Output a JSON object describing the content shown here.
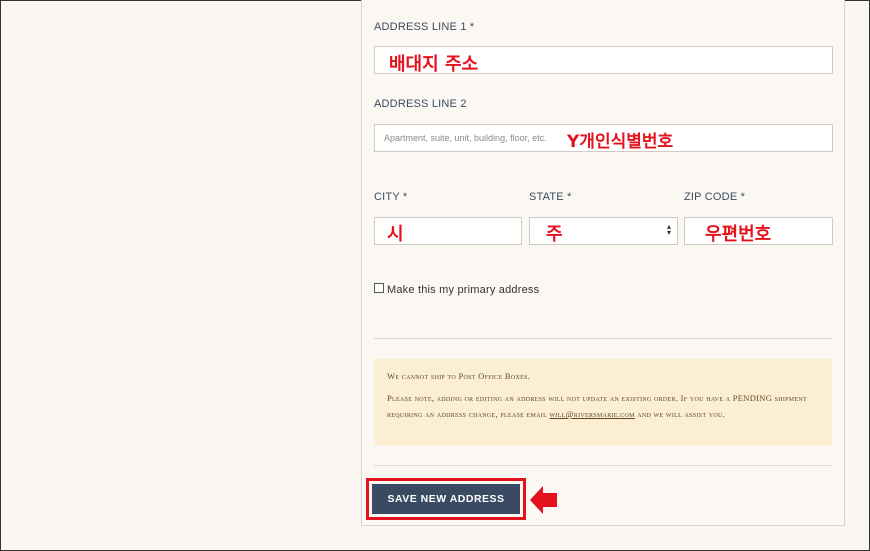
{
  "form": {
    "address_line1": {
      "label": "ADDRESS LINE 1 *",
      "annotation": "배대지 주소"
    },
    "address_line2": {
      "label": "ADDRESS LINE 2",
      "placeholder": "Apartment, suite, unit, building, floor, etc.",
      "annotation": "Y개인식별번호"
    },
    "city": {
      "label": "CITY *",
      "annotation": "시"
    },
    "state": {
      "label": "STATE *",
      "annotation": "주"
    },
    "zip": {
      "label": "ZIP CODE *",
      "annotation": "우편번호"
    },
    "primary_checkbox_label": "Make this my primary address",
    "primary_checked": false
  },
  "notice": {
    "line1": "We cannot ship to Post Office Boxes.",
    "line2_pre": "Please note, adding or editing an address will not update an existing order. If you have a PENDING shipment requiring an address change, please email ",
    "email": "will@riversmarie.com",
    "line2_post": " and we will assist you."
  },
  "actions": {
    "save_label": "SAVE NEW ADDRESS"
  },
  "colors": {
    "annotation_red": "#e3121c",
    "button_bg": "#3b4a63",
    "notice_bg": "#fbeed3"
  }
}
